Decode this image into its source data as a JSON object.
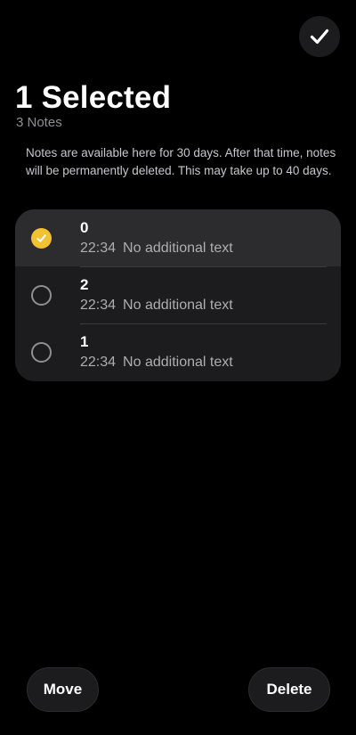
{
  "header": {
    "title": "1 Selected",
    "subtitle": "3 Notes",
    "info": "Notes are available here for 30 days. After that time, notes will be permanently deleted. This may take up to 40 days."
  },
  "icons": {
    "done": "checkmark-icon",
    "selected": "checkmark-icon"
  },
  "notes": [
    {
      "title": "0",
      "time": "22:34",
      "preview": "No additional text",
      "selected": true
    },
    {
      "title": "2",
      "time": "22:34",
      "preview": "No additional text",
      "selected": false
    },
    {
      "title": "1",
      "time": "22:34",
      "preview": "No additional text",
      "selected": false
    }
  ],
  "actions": {
    "move_label": "Move",
    "delete_label": "Delete"
  },
  "colors": {
    "background": "#000000",
    "card": "#1c1c1e",
    "selected_row": "#2c2c2e",
    "accent": "#f2c230",
    "secondary_text": "#8e8e93"
  }
}
